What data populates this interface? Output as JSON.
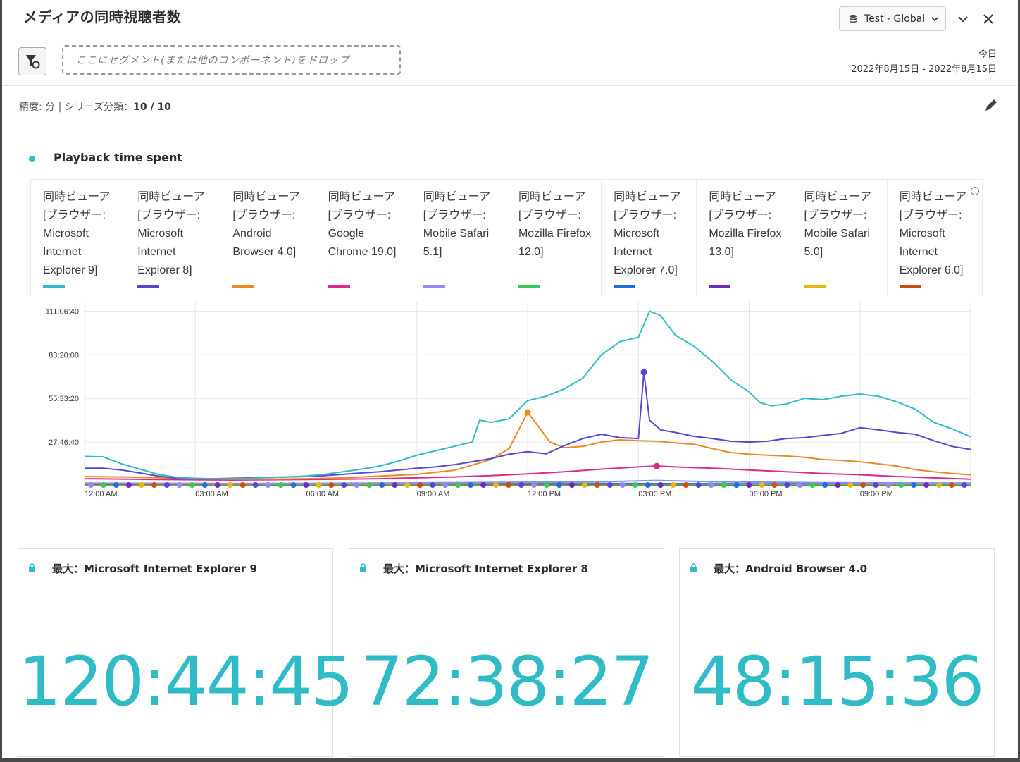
{
  "header": {
    "title": "メディアの同時視聴者数",
    "report_suite": "Test - Global"
  },
  "segment_bar": {
    "drop_placeholder": "ここにセグメント(または他のコンポーネント)をドロップ",
    "date_label": "今日",
    "date_range": "2022年8月15日 - 2022年8月15日"
  },
  "settings": {
    "prefix": "精度: 分 | シリーズ分類：",
    "series_count": "10 / 10"
  },
  "chart": {
    "title": "Playback time spent",
    "legend": [
      {
        "label": "同時ビューア [ブラウザー: Microsoft Internet Explorer 9]",
        "color": "#2fbcc6"
      },
      {
        "label": "同時ビューア [ブラウザー: Microsoft Internet Explorer 8]",
        "color": "#5547d6"
      },
      {
        "label": "同時ビューア [ブラウザー: Android Browser 4.0]",
        "color": "#ec8a22"
      },
      {
        "label": "同時ビューア [ブラウザー: Google Chrome 19.0]",
        "color": "#d92b8f"
      },
      {
        "label": "同時ビューア [ブラウザー: Mobile Safari 5.1]",
        "color": "#8f8cf5"
      },
      {
        "label": "同時ビューア [ブラウザー: Mozilla Firefox 12.0]",
        "color": "#37c95a"
      },
      {
        "label": "同時ビューア [ブラウザー: Microsoft Internet Explorer 7.0]",
        "color": "#1e6fdc"
      },
      {
        "label": "同時ビューア [ブラウザー: Mozilla Firefox 13.0]",
        "color": "#6b2bbf"
      },
      {
        "label": "同時ビューア [ブラウザー: Mobile Safari 5.0]",
        "color": "#e6b912"
      },
      {
        "label": "同時ビューア [ブラウザー: Microsoft Internet Explorer 6.0]",
        "color": "#c9500f"
      }
    ]
  },
  "chart_data": {
    "type": "line",
    "x_unit": "hours",
    "xlim": [
      0,
      24
    ],
    "xticks": [
      {
        "x": 0,
        "label": "12:00 AM"
      },
      {
        "x": 3,
        "label": "03:00 AM"
      },
      {
        "x": 6,
        "label": "06:00 AM"
      },
      {
        "x": 9,
        "label": "09:00 AM"
      },
      {
        "x": 12,
        "label": "12:00 PM"
      },
      {
        "x": 15,
        "label": "03:00 PM"
      },
      {
        "x": 18,
        "label": "06:00 PM"
      },
      {
        "x": 21,
        "label": "09:00 PM"
      }
    ],
    "ylim": [
      0,
      420000
    ],
    "yticks": [
      {
        "y": 100000,
        "label": "27:46:40"
      },
      {
        "y": 200000,
        "label": "55:33:20"
      },
      {
        "y": 300000,
        "label": "83:20:00"
      },
      {
        "y": 400000,
        "label": "111:06:40"
      }
    ],
    "grid": true,
    "series": [
      {
        "name": "同時ビューア [ブラウザー: Microsoft Internet Explorer 9]",
        "color": "#2fbcc6",
        "points": [
          [
            0,
            67000
          ],
          [
            0.5,
            66000
          ],
          [
            1,
            50000
          ],
          [
            1.5,
            38000
          ],
          [
            2,
            26000
          ],
          [
            2.5,
            19000
          ],
          [
            3,
            17000
          ],
          [
            3.5,
            16000
          ],
          [
            4,
            16000
          ],
          [
            4.5,
            17000
          ],
          [
            5,
            19000
          ],
          [
            5.5,
            20000
          ],
          [
            6,
            22000
          ],
          [
            6.5,
            26000
          ],
          [
            7,
            32000
          ],
          [
            7.5,
            38000
          ],
          [
            8,
            45000
          ],
          [
            8.5,
            56000
          ],
          [
            9,
            70000
          ],
          [
            9.5,
            80000
          ],
          [
            10,
            90000
          ],
          [
            10.5,
            100000
          ],
          [
            10.7,
            150000
          ],
          [
            11,
            145000
          ],
          [
            11.5,
            153000
          ],
          [
            12,
            195000
          ],
          [
            12.5,
            205000
          ],
          [
            13,
            222000
          ],
          [
            13.5,
            247000
          ],
          [
            14,
            300000
          ],
          [
            14.5,
            330000
          ],
          [
            15,
            340000
          ],
          [
            15.3,
            400000
          ],
          [
            15.6,
            390000
          ],
          [
            16,
            345000
          ],
          [
            16.5,
            320000
          ],
          [
            17,
            285000
          ],
          [
            17.5,
            243000
          ],
          [
            18,
            215000
          ],
          [
            18.3,
            190000
          ],
          [
            18.6,
            183000
          ],
          [
            19,
            187000
          ],
          [
            19.5,
            200000
          ],
          [
            20,
            197000
          ],
          [
            20.5,
            205000
          ],
          [
            21,
            210000
          ],
          [
            21.5,
            205000
          ],
          [
            22,
            192000
          ],
          [
            22.5,
            175000
          ],
          [
            23,
            145000
          ],
          [
            23.5,
            130000
          ],
          [
            24,
            112000
          ]
        ]
      },
      {
        "name": "同時ビューア [ブラウザー: Microsoft Internet Explorer 8]",
        "color": "#5547d6",
        "points": [
          [
            0,
            40000
          ],
          [
            0.5,
            40000
          ],
          [
            1,
            36000
          ],
          [
            1.5,
            29000
          ],
          [
            2,
            22000
          ],
          [
            2.5,
            17000
          ],
          [
            3,
            16000
          ],
          [
            3.5,
            16000
          ],
          [
            4,
            17000
          ],
          [
            4.5,
            18000
          ],
          [
            5,
            19000
          ],
          [
            5.5,
            20000
          ],
          [
            6,
            21000
          ],
          [
            6.5,
            23000
          ],
          [
            7,
            26000
          ],
          [
            7.5,
            29000
          ],
          [
            8,
            32000
          ],
          [
            8.5,
            36000
          ],
          [
            9,
            40000
          ],
          [
            9.5,
            43000
          ],
          [
            10,
            48000
          ],
          [
            10.5,
            55000
          ],
          [
            11,
            62000
          ],
          [
            11.5,
            72000
          ],
          [
            12,
            78000
          ],
          [
            12.5,
            73000
          ],
          [
            13,
            92000
          ],
          [
            13.5,
            108000
          ],
          [
            14,
            118000
          ],
          [
            14.5,
            110000
          ],
          [
            15,
            108000
          ],
          [
            15.15,
            260000
          ],
          [
            15.3,
            150000
          ],
          [
            15.6,
            128000
          ],
          [
            16,
            122000
          ],
          [
            16.5,
            113000
          ],
          [
            17,
            108000
          ],
          [
            17.5,
            102000
          ],
          [
            18,
            100000
          ],
          [
            18.5,
            102000
          ],
          [
            19,
            108000
          ],
          [
            19.5,
            110000
          ],
          [
            20,
            115000
          ],
          [
            20.5,
            120000
          ],
          [
            21,
            133000
          ],
          [
            21.5,
            128000
          ],
          [
            22,
            122000
          ],
          [
            22.5,
            118000
          ],
          [
            23,
            103000
          ],
          [
            23.5,
            90000
          ],
          [
            24,
            83000
          ]
        ]
      },
      {
        "name": "同時ビューア [ブラウザー: Android Browser 4.0]",
        "color": "#ec8a22",
        "points": [
          [
            0,
            21000
          ],
          [
            1,
            20000
          ],
          [
            2,
            18000
          ],
          [
            3,
            16000
          ],
          [
            4,
            15000
          ],
          [
            5,
            15000
          ],
          [
            6,
            16000
          ],
          [
            7,
            18000
          ],
          [
            8,
            22000
          ],
          [
            9,
            26000
          ],
          [
            10,
            35000
          ],
          [
            10.5,
            47000
          ],
          [
            11,
            60000
          ],
          [
            11.5,
            85000
          ],
          [
            12,
            168000
          ],
          [
            12.3,
            135000
          ],
          [
            12.6,
            100000
          ],
          [
            13,
            87000
          ],
          [
            13.5,
            90000
          ],
          [
            14,
            100000
          ],
          [
            14.5,
            105000
          ],
          [
            15,
            103000
          ],
          [
            15.5,
            102000
          ],
          [
            16,
            98000
          ],
          [
            16.5,
            95000
          ],
          [
            17,
            85000
          ],
          [
            17.5,
            76000
          ],
          [
            18,
            72000
          ],
          [
            18.5,
            70000
          ],
          [
            19,
            68000
          ],
          [
            19.5,
            65000
          ],
          [
            20,
            60000
          ],
          [
            20.5,
            58000
          ],
          [
            21,
            55000
          ],
          [
            21.5,
            50000
          ],
          [
            22,
            45000
          ],
          [
            22.5,
            37000
          ],
          [
            23,
            32000
          ],
          [
            23.5,
            28000
          ],
          [
            24,
            25000
          ]
        ]
      },
      {
        "name": "同時ビューア [ブラウザー: Google Chrome 19.0]",
        "color": "#d92b8f",
        "points": [
          [
            0,
            16000
          ],
          [
            2,
            14000
          ],
          [
            4,
            13000
          ],
          [
            6,
            14000
          ],
          [
            8,
            16000
          ],
          [
            10,
            20000
          ],
          [
            11,
            23000
          ],
          [
            12,
            27000
          ],
          [
            13,
            32000
          ],
          [
            14,
            38000
          ],
          [
            15,
            43000
          ],
          [
            15.5,
            45000
          ],
          [
            16,
            43000
          ],
          [
            17,
            40000
          ],
          [
            18,
            36000
          ],
          [
            19,
            32000
          ],
          [
            20,
            28000
          ],
          [
            21,
            25000
          ],
          [
            22,
            21000
          ],
          [
            23,
            18000
          ],
          [
            24,
            15000
          ]
        ]
      },
      {
        "name": "同時ビューア [ブラウザー: Mobile Safari 5.1]",
        "color": "#8f8cf5",
        "points": [
          [
            0,
            6000
          ],
          [
            4,
            5000
          ],
          [
            8,
            6000
          ],
          [
            12,
            8000
          ],
          [
            14,
            9000
          ],
          [
            15.5,
            12000
          ],
          [
            17,
            9000
          ],
          [
            20,
            7000
          ],
          [
            24,
            6000
          ]
        ]
      },
      {
        "name": "同時ビューア [ブラウザー: Mozilla Firefox 12.0]",
        "color": "#37c95a",
        "points": [
          [
            0,
            4000
          ],
          [
            6,
            3000
          ],
          [
            12,
            4000
          ],
          [
            18,
            3000
          ],
          [
            24,
            3000
          ]
        ]
      },
      {
        "name": "同時ビューア [ブラウザー: Microsoft Internet Explorer 7.0]",
        "color": "#1e6fdc",
        "points": [
          [
            0,
            5000
          ],
          [
            6,
            4500
          ],
          [
            12,
            5500
          ],
          [
            18,
            4500
          ],
          [
            24,
            4000
          ]
        ]
      },
      {
        "name": "同時ビューア [ブラウザー: Mozilla Firefox 13.0]",
        "color": "#6b2bbf",
        "points": [
          [
            0,
            3000
          ],
          [
            6,
            2500
          ],
          [
            12,
            3000
          ],
          [
            18,
            2500
          ],
          [
            24,
            2500
          ]
        ]
      },
      {
        "name": "同時ビューア [ブラウザー: Mobile Safari 5.0]",
        "color": "#e6b912",
        "points": [
          [
            0,
            2000
          ],
          [
            6,
            2000
          ],
          [
            12,
            2500
          ],
          [
            18,
            2000
          ],
          [
            24,
            2000
          ]
        ]
      },
      {
        "name": "同時ビューア [ブラウザー: Microsoft Internet Explorer 6.0]",
        "color": "#c9500f",
        "points": [
          [
            0,
            1500
          ],
          [
            6,
            1500
          ],
          [
            12,
            1500
          ],
          [
            18,
            1500
          ],
          [
            24,
            1500
          ]
        ]
      }
    ],
    "peak_markers": [
      {
        "series_index": 1,
        "x": 15.15,
        "y": 260000
      },
      {
        "series_index": 2,
        "x": 12.0,
        "y": 168000
      },
      {
        "series_index": 3,
        "x": 15.5,
        "y": 45000
      }
    ]
  },
  "kpis": [
    {
      "label": "最大：Microsoft Internet Explorer 9",
      "value": "120:44:45"
    },
    {
      "label": "最大：Microsoft Internet Explorer 8",
      "value": "72:38:27"
    },
    {
      "label": "最大：Android Browser 4.0",
      "value": "48:15:36"
    }
  ],
  "icons": {
    "filter": "filter-icon",
    "database": "database-icon",
    "collapse": "chevron-down-icon",
    "close": "close-icon",
    "edit": "pencil-icon",
    "lock": "lock-icon"
  }
}
